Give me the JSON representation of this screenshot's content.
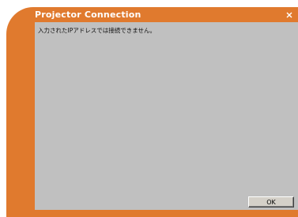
{
  "window": {
    "title": "Projector Connection"
  },
  "dialog": {
    "message": "入力されたIPアドレスでは接続できません。",
    "ok_label": "OK"
  },
  "icons": {
    "close": "close-icon"
  },
  "colors": {
    "frame": "#e07a2e",
    "content_background": "#c0c0c0",
    "title_text": "#ffffff"
  }
}
